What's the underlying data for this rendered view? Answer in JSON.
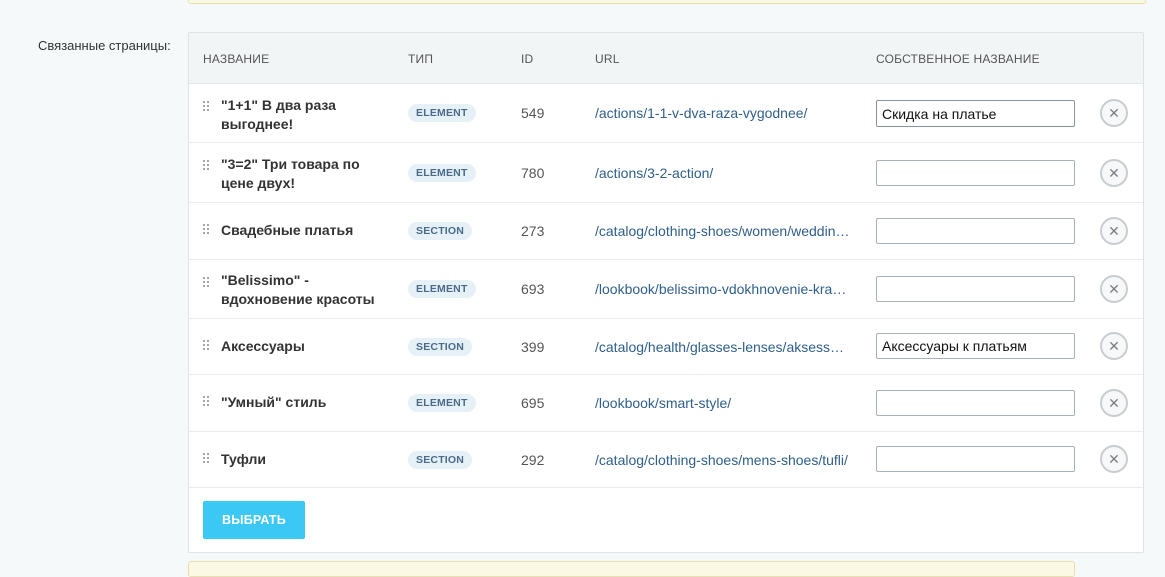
{
  "field_label": "Связанные страницы:",
  "columns": {
    "name": "НАЗВАНИЕ",
    "type": "ТИП",
    "id": "ID",
    "url": "URL",
    "own_name": "СОБСТВЕННОЕ НАЗВАНИЕ"
  },
  "rows": [
    {
      "name": "\"1+1\" В два раза выгоднее!",
      "type": "ELEMENT",
      "id": "549",
      "url": "/actions/1-1-v-dva-raza-vygodnee/",
      "own_name": "Скидка на платье"
    },
    {
      "name": "\"3=2\" Три товара по цене двух!",
      "type": "ELEMENT",
      "id": "780",
      "url": "/actions/3-2-action/",
      "own_name": ""
    },
    {
      "name": "Свадебные платья",
      "type": "SECTION",
      "id": "273",
      "url": "/catalog/clothing-shoes/women/wedding-dresses/",
      "own_name": ""
    },
    {
      "name": "\"Belissimo\" - вдохновение красоты",
      "type": "ELEMENT",
      "id": "693",
      "url": "/lookbook/belissimo-vdokhnovenie-krasoty/",
      "own_name": ""
    },
    {
      "name": "Аксессуары",
      "type": "SECTION",
      "id": "399",
      "url": "/catalog/health/glasses-lenses/aksessuary/",
      "own_name": "Аксессуары к платьям"
    },
    {
      "name": "\"Умный\" стиль",
      "type": "ELEMENT",
      "id": "695",
      "url": "/lookbook/smart-style/",
      "own_name": ""
    },
    {
      "name": "Туфли",
      "type": "SECTION",
      "id": "292",
      "url": "/catalog/clothing-shoes/mens-shoes/tufli/",
      "own_name": ""
    }
  ],
  "select_button": "ВЫБРАТЬ",
  "icons": {
    "drag": "drag-handle-icon",
    "remove": "close-icon"
  },
  "colors": {
    "accent": "#3bc8f5",
    "link": "#2f5f8a",
    "badge_bg": "#e6f0f7"
  }
}
